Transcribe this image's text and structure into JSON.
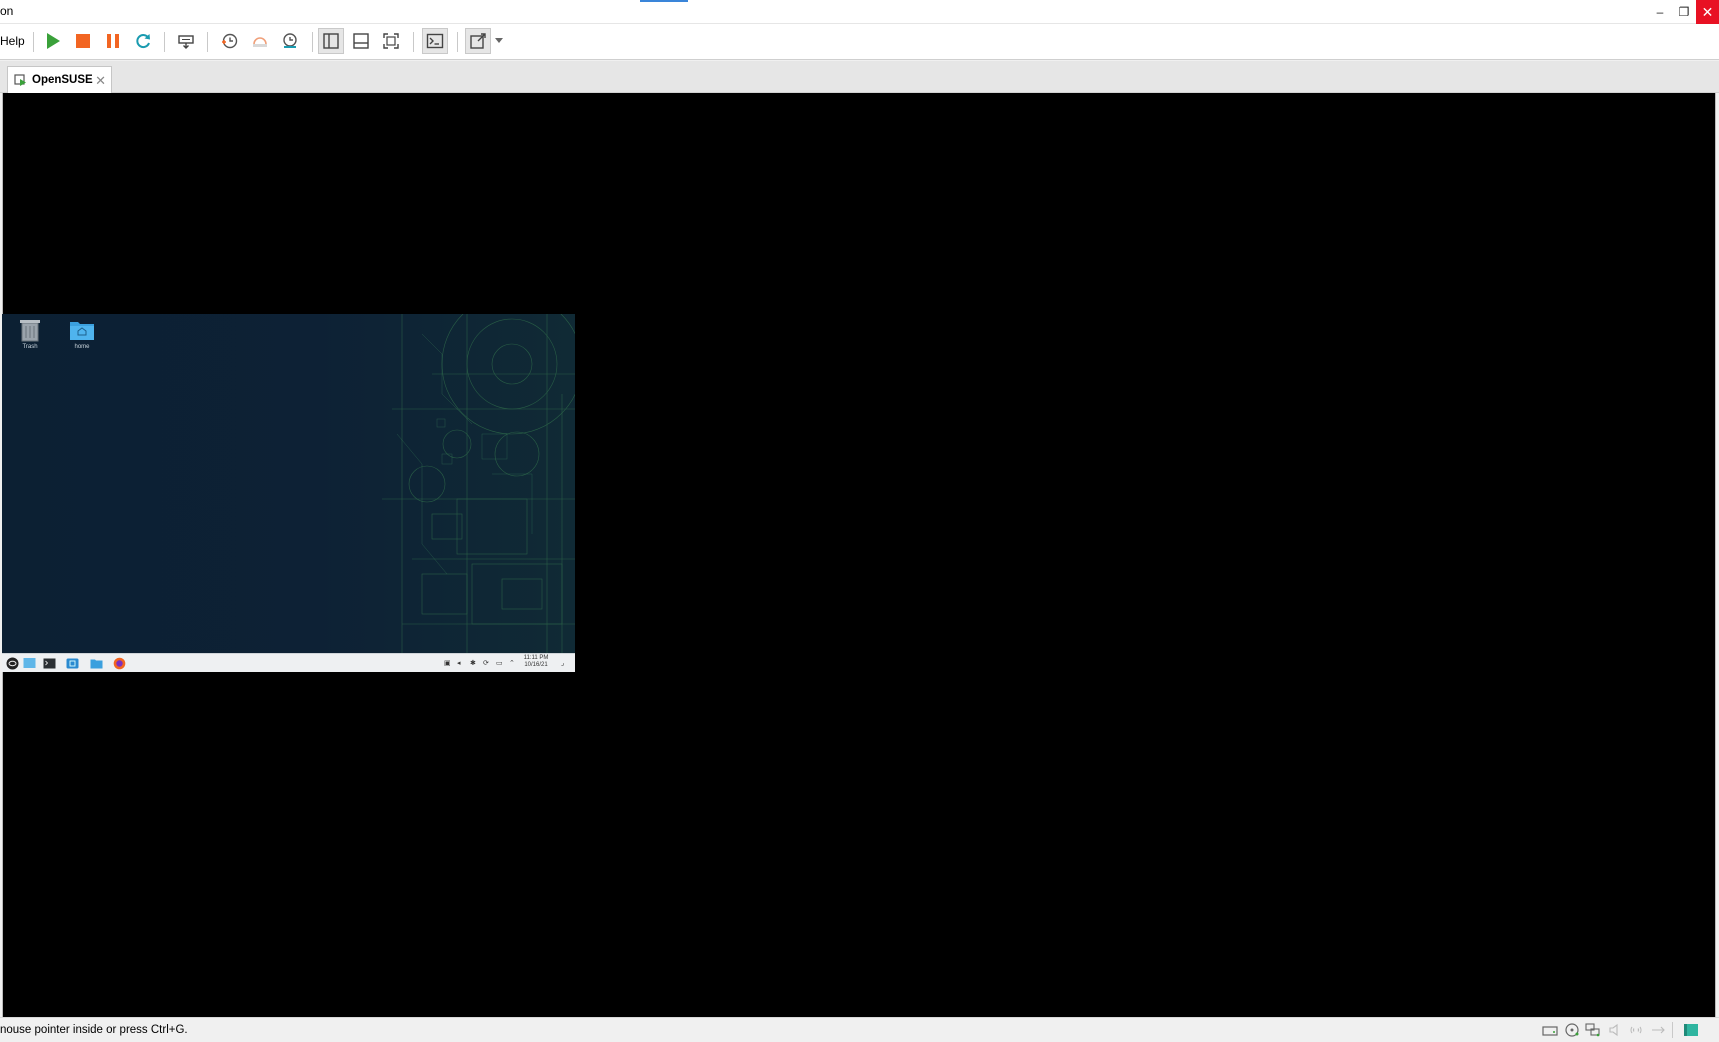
{
  "window": {
    "title_fragment": "on",
    "minimize_glyph": "–",
    "restore_glyph": "❐",
    "close_glyph": "✕"
  },
  "menu": {
    "help_fragment": "Help"
  },
  "tabs": [
    {
      "label": "OpenSUSE",
      "close_glyph": "✕"
    }
  ],
  "guest": {
    "desktop_icons": [
      {
        "label": "Trash",
        "icon": "trash-icon"
      },
      {
        "label": "home",
        "icon": "home-folder-icon"
      }
    ],
    "clock_time": "11:11 PM",
    "clock_date": "10/16/21"
  },
  "status": {
    "text": "nouse pointer inside or press Ctrl+G."
  },
  "colors": {
    "run": "#3aa13a",
    "stop": "#f26522",
    "pause": "#f26522",
    "refresh": "#1a9bb0",
    "close_red": "#e81123"
  }
}
